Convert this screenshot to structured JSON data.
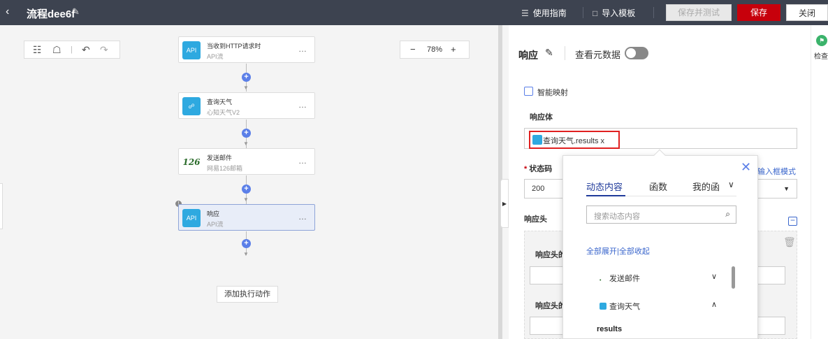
{
  "topbar": {
    "back_icon": "chevron-left-icon",
    "title": "流程dee6f",
    "edit_icon": "pencil-icon",
    "guide_label": "使用指南",
    "import_label": "导入模板",
    "save_test_label": "保存并测试",
    "save_label": "保存",
    "close_label": "关闭",
    "save_color": "#c7000b"
  },
  "canvas": {
    "zoom": "78%",
    "nodes": [
      {
        "title": "当收到HTTP请求时",
        "subtitle": "API流",
        "icon": "API"
      },
      {
        "title": "查询天气",
        "subtitle": "心知天气V2",
        "icon": "weather"
      },
      {
        "title": "发送邮件",
        "subtitle": "网易126邮箱",
        "icon": "126"
      },
      {
        "title": "响应",
        "subtitle": "API流",
        "icon": "API"
      }
    ],
    "add_action_label": "添加执行动作"
  },
  "panel": {
    "title": "响应",
    "meta_label": "查看元数据",
    "smart_map_label": "智能映射",
    "body_label": "响应体",
    "body_tag": "查询天气.results x",
    "status_label": "状态码",
    "mode_link": "输入框模式",
    "status_value": "200",
    "headers_label": "响应头",
    "header_key_label_1": "响应头的",
    "header_key_label_2": "响应头的"
  },
  "rightrail": {
    "label": "检查"
  },
  "popup": {
    "tabs": [
      "动态内容",
      "函数",
      "我的函"
    ],
    "search_placeholder": "搜索动态内容",
    "expand_all": "全部展开",
    "collapse_all": "全部收起",
    "items": [
      {
        "label": "发送邮件",
        "expanded": false
      },
      {
        "label": "查询天气",
        "expanded": true
      }
    ],
    "results_label": "results",
    "accent": "#1f3a9a"
  }
}
